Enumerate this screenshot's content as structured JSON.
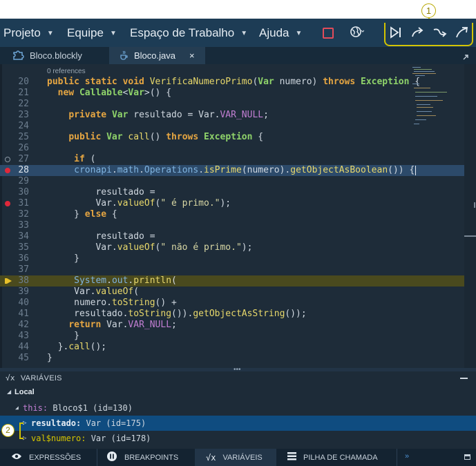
{
  "callouts": [
    "1",
    "2"
  ],
  "menu": {
    "items": [
      {
        "label": "Projeto"
      },
      {
        "label": "Equipe"
      },
      {
        "label": "Espaço de Trabalho"
      },
      {
        "label": "Ajuda"
      }
    ]
  },
  "tabs": [
    {
      "label": "Bloco.blockly",
      "icon": "blockly-puzzle-icon"
    },
    {
      "label": "Bloco.java",
      "icon": "java-cup-icon",
      "close": "×"
    }
  ],
  "editor": {
    "references": "0 references",
    "lines": [
      {
        "n": "20",
        "html": "<span class=\"kw\">public static void</span> <span class=\"fn\">VerificaNumeroPrimo</span>(<span class=\"ty\">Var</span> numero) <span class=\"kw\">throws</span> <span class=\"ty\">Exception</span> {"
      },
      {
        "n": "21",
        "html": "  <span class=\"kw\">new</span> <span class=\"ty\">Callable</span>&lt;<span class=\"ty\">Var</span>&gt;() {"
      },
      {
        "n": "22",
        "html": ""
      },
      {
        "n": "23",
        "html": "    <span class=\"kw\">private</span> <span class=\"ty\">Var</span> resultado = Var.<span class=\"cst\">VAR_NULL</span>;"
      },
      {
        "n": "24",
        "html": ""
      },
      {
        "n": "25",
        "html": "    <span class=\"kw\">public</span> <span class=\"ty\">Var</span> <span class=\"fn\">call</span>() <span class=\"kw\">throws</span> <span class=\"ty\">Exception</span> {"
      },
      {
        "n": "26",
        "html": ""
      },
      {
        "n": "27",
        "html": "     <span class=\"kw\">if</span> ("
      },
      {
        "n": "28",
        "html": "     <span class=\"pkg\">cronapi</span>.<span class=\"pkg\">math</span>.<span class=\"pkg\">Operations</span>.<span class=\"fn\">isPrime</span>(numero).<span class=\"fn\">getObjectAsBoolean</span>()) {"
      },
      {
        "n": "29",
        "html": ""
      },
      {
        "n": "30",
        "html": "         resultado ="
      },
      {
        "n": "31",
        "html": "         Var.<span class=\"fn\">valueOf</span>(<span class=\"str\">\" é primo.\"</span>);"
      },
      {
        "n": "32",
        "html": "     } <span class=\"kw\">else</span> {"
      },
      {
        "n": "33",
        "html": ""
      },
      {
        "n": "34",
        "html": "         resultado ="
      },
      {
        "n": "35",
        "html": "         Var.<span class=\"fn\">valueOf</span>(<span class=\"str\">\" não é primo.\"</span>);"
      },
      {
        "n": "36",
        "html": "     }"
      },
      {
        "n": "37",
        "html": ""
      },
      {
        "n": "38",
        "html": "     <span class=\"pkg\">System</span>.<span class=\"pkg\">out</span>.<span class=\"fn\">println</span>("
      },
      {
        "n": "39",
        "html": "     Var.<span class=\"fn\">valueOf</span>("
      },
      {
        "n": "40",
        "html": "     numero.<span class=\"fn\">toString</span>() +"
      },
      {
        "n": "41",
        "html": "     resultado.<span class=\"fn\">toString</span>()).<span class=\"fn\">getObjectAsString</span>());"
      },
      {
        "n": "42",
        "html": "    <span class=\"kw\">return</span> Var.<span class=\"cst\">VAR_NULL</span>;"
      },
      {
        "n": "43",
        "html": "     }"
      },
      {
        "n": "44",
        "html": "  }.<span class=\"fn\">call</span>();"
      },
      {
        "n": "45",
        "html": "}"
      }
    ]
  },
  "variables": {
    "title": "VARIÁVEIS",
    "rows": [
      {
        "name": "Local",
        "value": ""
      },
      {
        "name": "this:",
        "value": " Bloco$1 (id=130)"
      },
      {
        "name": "resultado:",
        "value": " Var (id=175)"
      },
      {
        "name": "val$numero:",
        "value": " Var (id=178)"
      }
    ]
  },
  "bottom_tabs": [
    {
      "label": "EXPRESSÕES",
      "icon": "eye-icon"
    },
    {
      "label": "BREAKPOINTS",
      "icon": "pause-icon"
    },
    {
      "label": "VARIÁVEIS",
      "icon": "sqrt-x-icon"
    },
    {
      "label": "PILHA DE CHAMADA",
      "icon": "stack-icon"
    }
  ],
  "overflow_glyph": "»"
}
